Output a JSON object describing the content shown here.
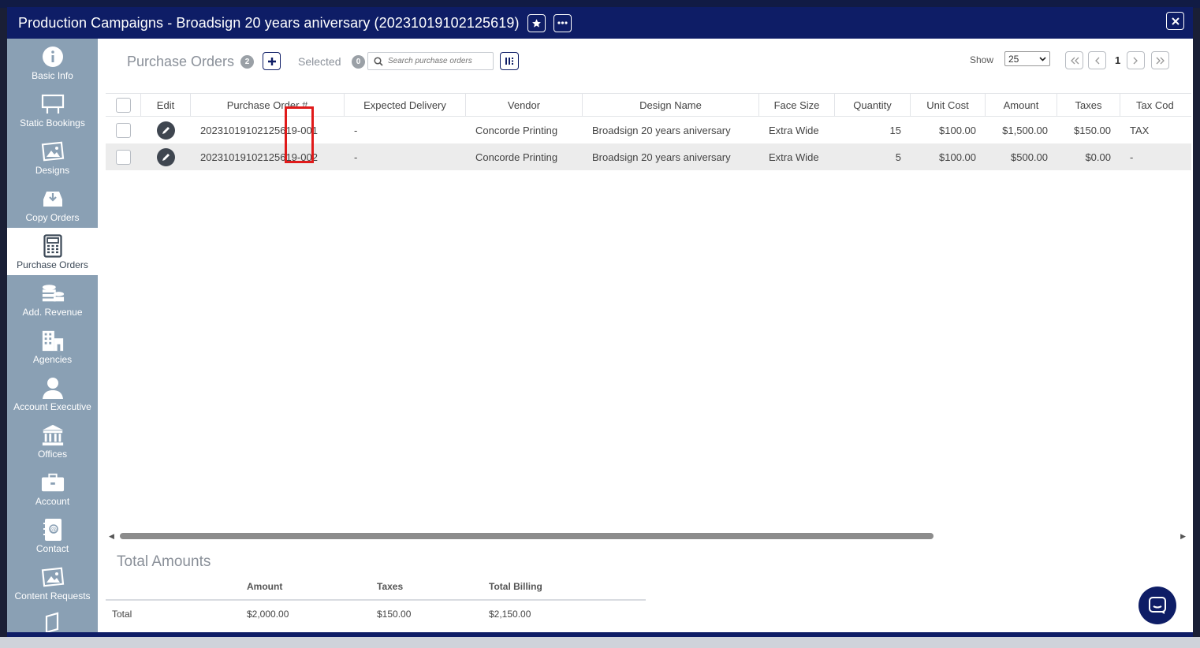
{
  "window": {
    "title": "Production Campaigns - Broadsign 20 years aniversary (20231019102125619)"
  },
  "sidebar": {
    "items": [
      {
        "label": "Basic Info",
        "icon": "info-icon"
      },
      {
        "label": "Static Bookings",
        "icon": "billboard-icon"
      },
      {
        "label": "Designs",
        "icon": "image-icon"
      },
      {
        "label": "Copy Orders",
        "icon": "inbox-download-icon"
      },
      {
        "label": "Purchase Orders",
        "icon": "calculator-icon",
        "active": true
      },
      {
        "label": "Add. Revenue",
        "icon": "coins-icon"
      },
      {
        "label": "Agencies",
        "icon": "buildings-icon"
      },
      {
        "label": "Account Executive",
        "icon": "user-icon"
      },
      {
        "label": "Offices",
        "icon": "bank-icon"
      },
      {
        "label": "Account",
        "icon": "briefcase-icon"
      },
      {
        "label": "Contact",
        "icon": "address-book-icon"
      },
      {
        "label": "Content Requests",
        "icon": "image-icon"
      },
      {
        "label": "",
        "icon": "document-icon"
      }
    ]
  },
  "toolbar": {
    "title": "Purchase Orders",
    "count": "2",
    "selected_label": "Selected",
    "selected_count": "0",
    "search_placeholder": "Search purchase orders",
    "show_label": "Show",
    "show_value": "25",
    "current_page": "1"
  },
  "table": {
    "headers": [
      "",
      "Edit",
      "Purchase Order #",
      "Expected Delivery",
      "Vendor",
      "Design Name",
      "Face Size",
      "Quantity",
      "Unit Cost",
      "Amount",
      "Taxes",
      "Tax Cod"
    ],
    "rows": [
      {
        "po": "20231019102125619-001",
        "delivery": "-",
        "vendor": "Concorde Printing",
        "design": "Broadsign 20 years aniversary",
        "face": "Extra Wide",
        "qty": "15",
        "unit": "$100.00",
        "amount": "$1,500.00",
        "taxes": "$150.00",
        "taxcode": "TAX"
      },
      {
        "po": "20231019102125619-002",
        "delivery": "-",
        "vendor": "Concorde Printing",
        "design": "Broadsign 20 years aniversary",
        "face": "Extra Wide",
        "qty": "5",
        "unit": "$100.00",
        "amount": "$500.00",
        "taxes": "$0.00",
        "taxcode": "-"
      }
    ]
  },
  "totals": {
    "title": "Total Amounts",
    "headers": [
      "Amount",
      "Taxes",
      "Total Billing"
    ],
    "row_label": "Total",
    "amount": "$2,000.00",
    "taxes": "$150.00",
    "total_billing": "$2,150.00"
  },
  "colors": {
    "brand": "#0e1d66",
    "sidebar": "#8aa0b4",
    "highlight": "#e01a1a"
  }
}
